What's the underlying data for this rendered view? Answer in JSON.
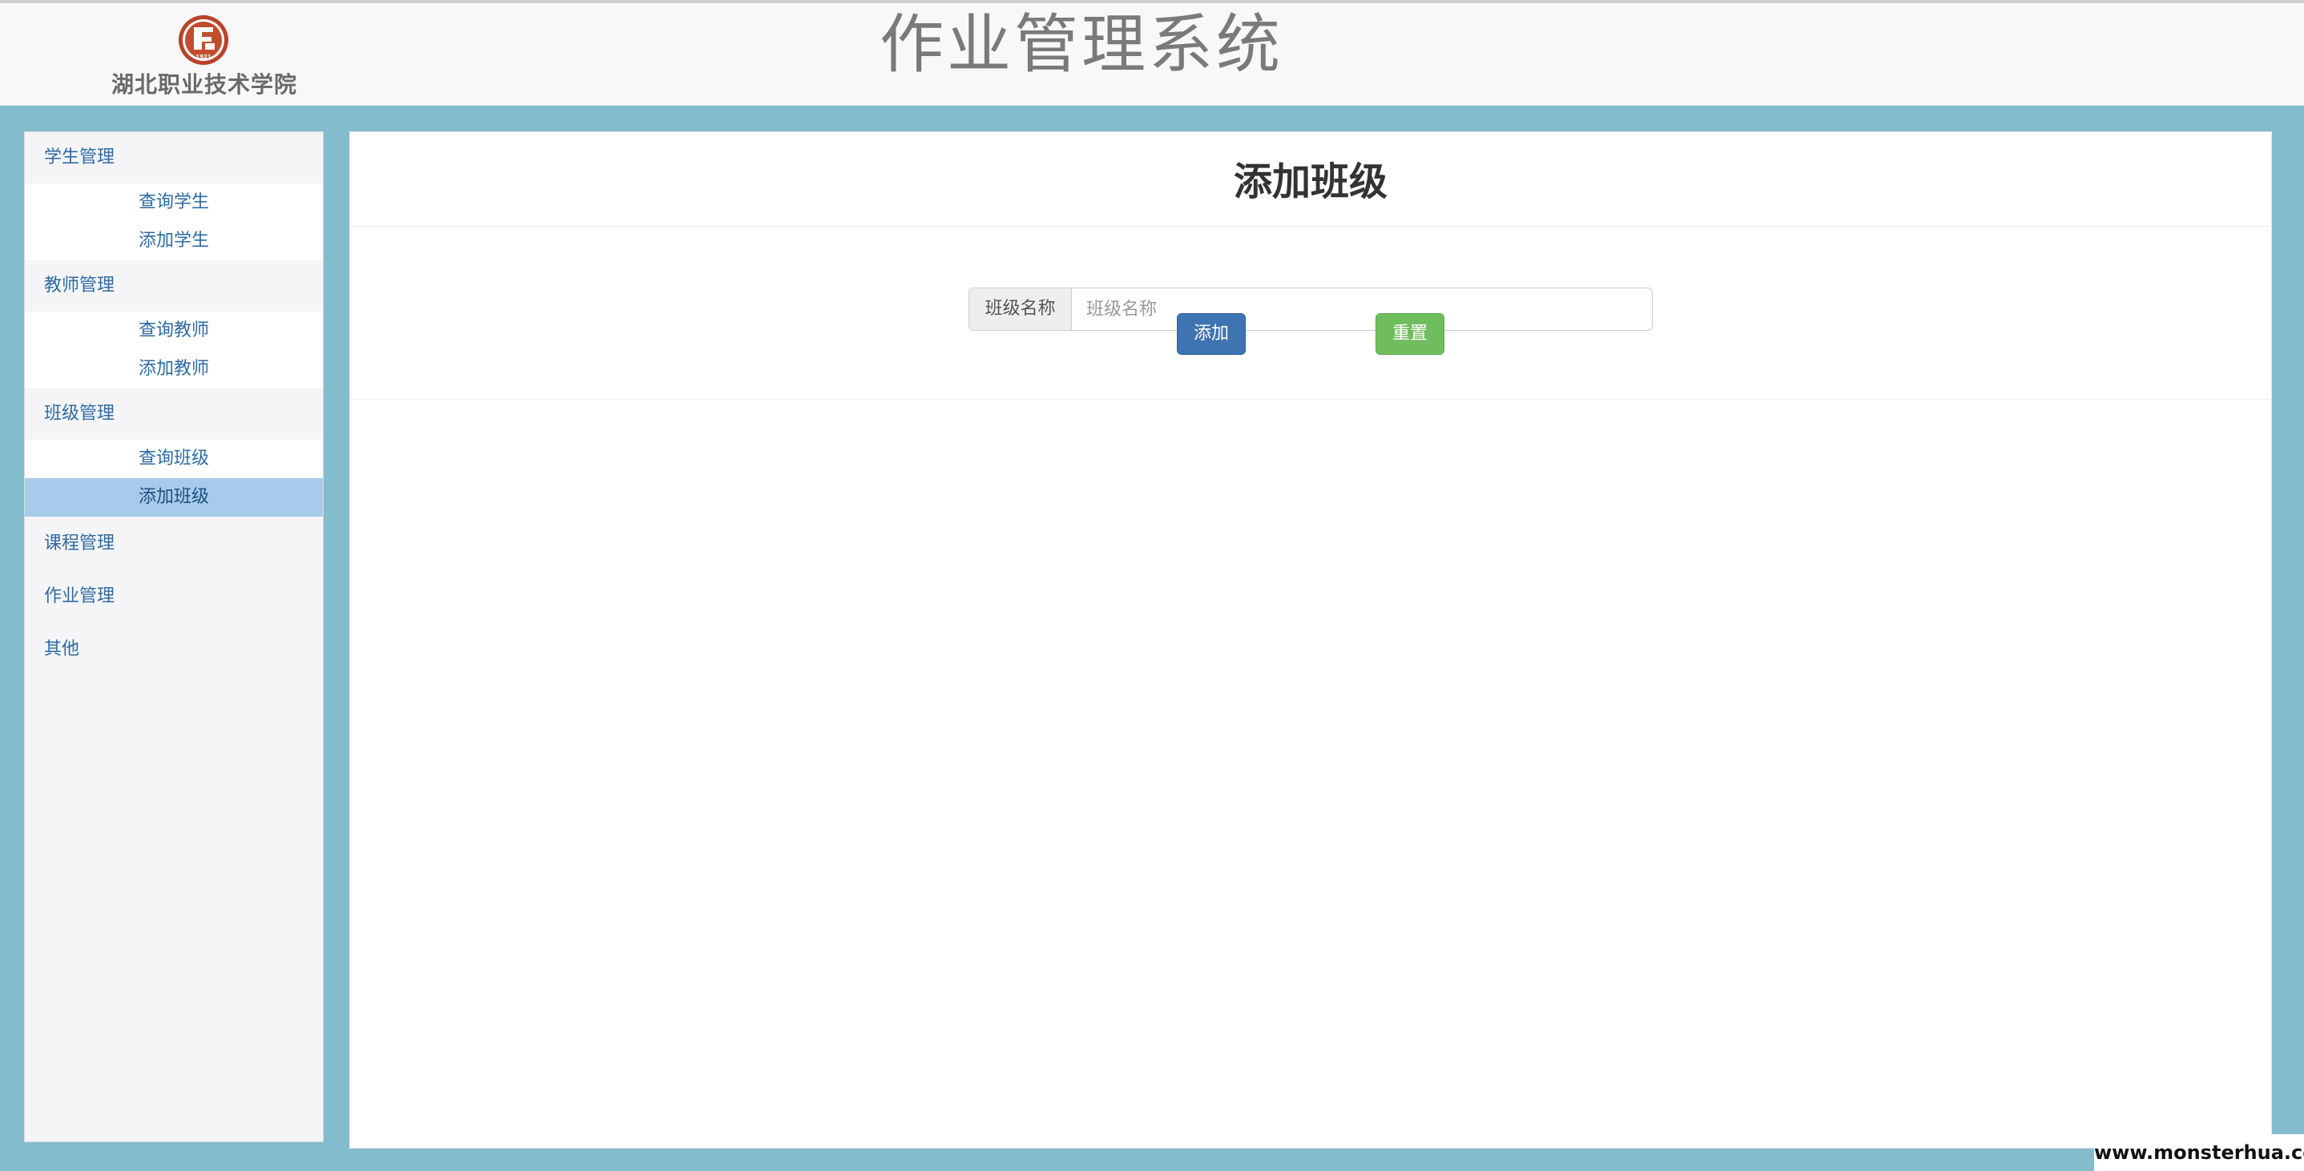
{
  "header": {
    "school_name": "湖北职业技术学院",
    "seal_year": "1921",
    "app_title": "作业管理系统"
  },
  "sidebar": {
    "groups": [
      {
        "label": "学生管理",
        "items": [
          {
            "label": "查询学生"
          },
          {
            "label": "添加学生"
          }
        ]
      },
      {
        "label": "教师管理",
        "items": [
          {
            "label": "查询教师"
          },
          {
            "label": "添加教师"
          }
        ]
      },
      {
        "label": "班级管理",
        "items": [
          {
            "label": "查询班级"
          },
          {
            "label": "添加班级",
            "active": true
          }
        ]
      },
      {
        "label": "课程管理",
        "items": []
      },
      {
        "label": "作业管理",
        "items": []
      },
      {
        "label": "其他",
        "items": []
      }
    ]
  },
  "main": {
    "title": "添加班级",
    "form": {
      "class_name_label": "班级名称",
      "class_name_placeholder": "班级名称",
      "class_name_value": "",
      "add_button": "添加",
      "reset_button": "重置"
    }
  },
  "colors": {
    "background": "#83bccc",
    "link": "#2e6ba2",
    "active_item": "#a7cbea",
    "primary_button": "#3f74b2",
    "success_button": "#6fbd5d"
  },
  "watermark": "www.monsterhua.com"
}
